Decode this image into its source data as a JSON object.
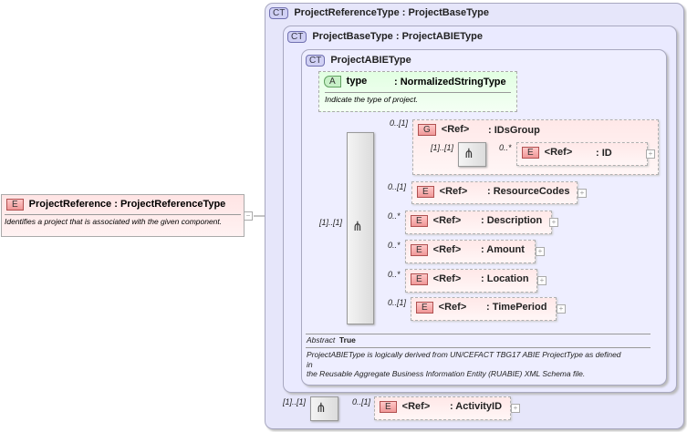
{
  "root": {
    "badge": "E",
    "name": "ProjectReference",
    "type": ": ProjectReferenceType",
    "description": "Identifies a project that is associated with the given component."
  },
  "ct1": {
    "badge": "CT",
    "name": "ProjectReferenceType",
    "base": ": ProjectBaseType"
  },
  "ct2": {
    "badge": "CT",
    "name": "ProjectBaseType",
    "base": ": ProjectABIEType"
  },
  "ct3": {
    "badge": "CT",
    "name": "ProjectABIEType"
  },
  "attribute": {
    "badge": "A",
    "name": "type",
    "type": ": NormalizedStringType",
    "description": "Indicate the type of project."
  },
  "group": {
    "badge": "G",
    "ref": "<Ref>",
    "name": ": IDsGroup",
    "card": "0..[1]",
    "seq_card": "[1]..[1]",
    "id": {
      "badge": "E",
      "ref": "<Ref>",
      "name": ": ID",
      "card": "0..*"
    }
  },
  "sequence_card": "[1]..[1]",
  "elements": [
    {
      "badge": "E",
      "ref": "<Ref>",
      "name": ": ResourceCodes",
      "card": "0..[1]"
    },
    {
      "badge": "E",
      "ref": "<Ref>",
      "name": ": Description",
      "card": "0..*"
    },
    {
      "badge": "E",
      "ref": "<Ref>",
      "name": ": Amount",
      "card": "0..*"
    },
    {
      "badge": "E",
      "ref": "<Ref>",
      "name": ": Location",
      "card": "0..*"
    },
    {
      "badge": "E",
      "ref": "<Ref>",
      "name": ": TimePeriod",
      "card": "0..[1]"
    }
  ],
  "abstract": {
    "label": "Abstract",
    "value": "True"
  },
  "abie_note": {
    "line1": "ProjectABIEType is logically derived from UN/CEFACT TBG17 ABIE ProjectType as defined",
    "line2": "in",
    "line3": "the Reusable Aggregate Business Information Entity (RUABIE) XML Schema file."
  },
  "bottom": {
    "seq_card": "[1]..[1]",
    "activity": {
      "badge": "E",
      "ref": "<Ref>",
      "name": ": ActivityID",
      "card": "0..[1]"
    }
  },
  "plus": "+"
}
